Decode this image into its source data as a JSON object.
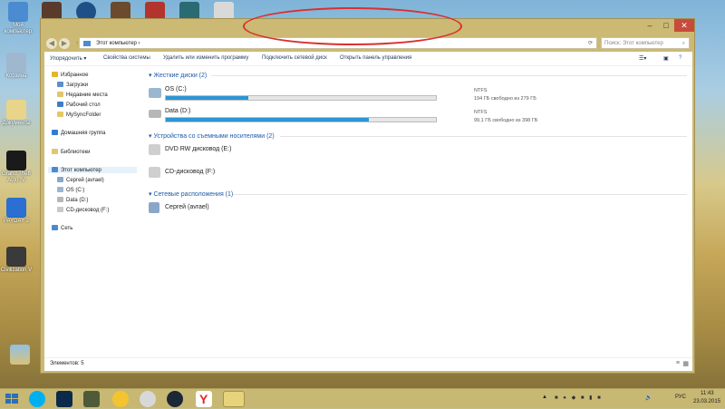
{
  "desktop": {
    "icons": [
      {
        "label": "Мой компьютер",
        "color": "#4a8bd1"
      },
      {
        "label": "Корзина",
        "color": "#9fb8cf"
      },
      {
        "label": "Документы",
        "color": "#e8d58a"
      },
      {
        "label": "Grand Theft Auto IV",
        "color": "#1a1a1a"
      },
      {
        "label": "PAYDAY 2",
        "color": "#2a6fd1"
      },
      {
        "label": "Civilization V",
        "color": "#3a3a3a"
      }
    ],
    "top_icons": [
      "#5a3a2a",
      "#1f4f87",
      "#6b4a2e",
      "#b3342c",
      "#2a6a72",
      "#d9d9d9"
    ]
  },
  "window": {
    "address": {
      "path": "Этот компьютер",
      "search_placeholder": "Поиск: Этот компьютер"
    },
    "toolbar": {
      "organize": "Упорядочить",
      "system_properties": "Свойства системы",
      "uninstall": "Удалить или изменить программу",
      "map_drive": "Подключить сетевой диск",
      "control_panel": "Открыть панель управления"
    },
    "nav": {
      "favorites": "Избранное",
      "downloads": "Загрузки",
      "recent": "Недавние места",
      "desktop": "Рабочий стол",
      "mysync": "MySyncFolder",
      "homegroup": "Домашняя группа",
      "libraries": "Библиотеки",
      "this_pc": "Этот компьютер",
      "user": "Сергей (avrael)",
      "drive_c": "OS (C:)",
      "drive_d": "Data (D:)",
      "drive_f": "CD-дисковод (F:)",
      "network": "Сеть"
    },
    "content": {
      "hard_disks_header": "Жесткие диски (2)",
      "drives": [
        {
          "name": "OS (C:)",
          "fs": "NTFS",
          "free": "194 ГБ свободно из 279 ГБ",
          "used_fraction": 0.305
        },
        {
          "name": "Data (D:)",
          "fs": "NTFS",
          "free": "99,1 ГБ свободно из 398 ГБ",
          "used_fraction": 0.751
        }
      ],
      "removable_header": "Устройства со съемными носителями (2)",
      "dvd": "DVD RW дисковод (E:)",
      "cd": "CD-дисковод (F:)",
      "network_header": "Сетевые расположения (1)",
      "network_item": "Сергей (avrael)"
    },
    "status": {
      "items": "Элементов: 5"
    }
  },
  "taskbar": {
    "lang": "РУС",
    "time": "11:43",
    "date": "23.03.2015"
  },
  "colors": {
    "accent": "#2b95d5",
    "link": "#1e5aa8",
    "annotation": "#d93030",
    "frame": "#cbb974"
  }
}
